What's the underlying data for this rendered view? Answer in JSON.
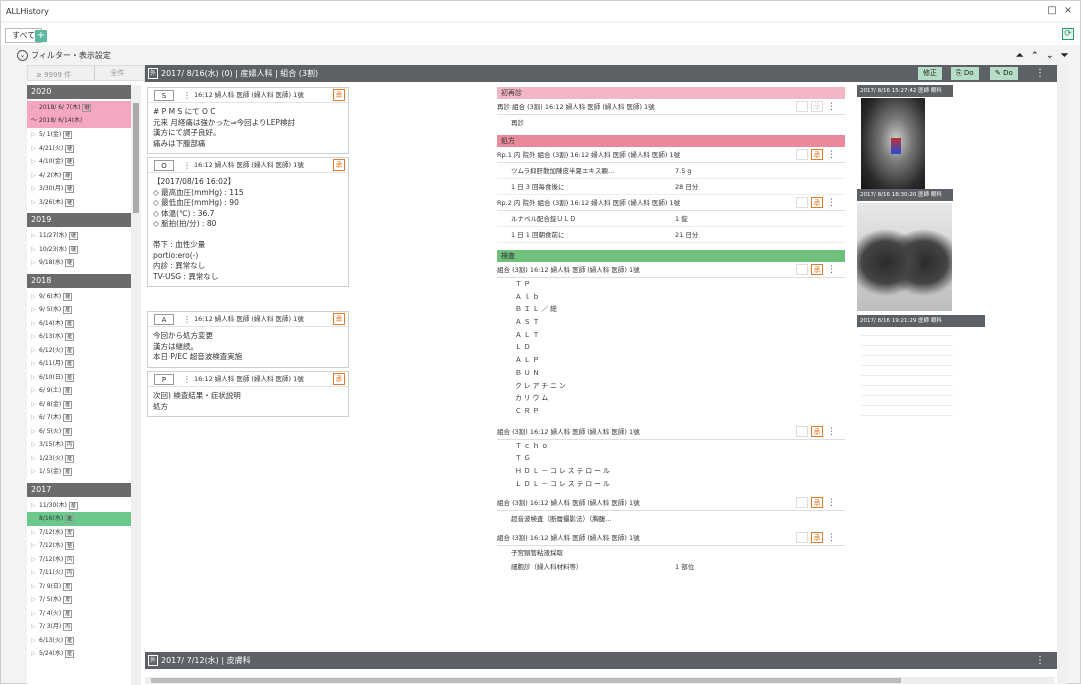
{
  "window": {
    "title": "ALLHistory",
    "minimize": "□",
    "close": "×"
  },
  "tabs": {
    "all": "すべて",
    "add": "+"
  },
  "filter": {
    "toggle": "⊙",
    "label": "フィルター・表示設定"
  },
  "counts": {
    "count": "≥ 9999 件",
    "all": "全件"
  },
  "years": [
    {
      "year": "2020",
      "items": [
        {
          "date": "2018/ 6/ 7(木)",
          "badge": "継",
          "extra": "～ 2018/ 6/14(木)",
          "hl": "pink"
        },
        {
          "date": "5/ 1(金)",
          "badge": "継"
        },
        {
          "date": "4/21(火)",
          "badge": "継"
        },
        {
          "date": "4/10(金)",
          "badge": "継"
        },
        {
          "date": "4/ 2(木)",
          "badge": "継"
        },
        {
          "date": "3/30(月)",
          "badge": "継"
        },
        {
          "date": "3/26(木)",
          "badge": "継"
        }
      ]
    },
    {
      "year": "2019",
      "items": [
        {
          "date": "11/27(水)",
          "badge": "継"
        },
        {
          "date": "10/23(水)",
          "badge": "継"
        },
        {
          "date": "9/18(水)",
          "badge": "継"
        }
      ]
    },
    {
      "year": "2018",
      "items": [
        {
          "date": "9/ 6(木)",
          "badge": "継"
        },
        {
          "date": "9/ 5(水)",
          "badge": "産"
        },
        {
          "date": "6/14(木)",
          "badge": "産"
        },
        {
          "date": "6/13(水)",
          "badge": "産"
        },
        {
          "date": "6/12(火)",
          "badge": "産"
        },
        {
          "date": "6/11(月)",
          "badge": "産"
        },
        {
          "date": "6/10(日)",
          "badge": "産"
        },
        {
          "date": "6/ 9(土)",
          "badge": "産"
        },
        {
          "date": "6/ 8(金)",
          "badge": "産"
        },
        {
          "date": "6/ 7(木)",
          "badge": "産"
        },
        {
          "date": "6/ 5(火)",
          "badge": "産"
        },
        {
          "date": "3/15(木)",
          "badge": "内"
        },
        {
          "date": "1/23(火)",
          "badge": "産"
        },
        {
          "date": "1/ 5(金)",
          "badge": "産"
        }
      ]
    },
    {
      "year": "2017",
      "items": [
        {
          "date": "11/30(木)",
          "badge": "産"
        },
        {
          "date": "8/16(水)",
          "badge": "産",
          "hl": "sel"
        },
        {
          "date": "7/12(水)",
          "badge": "皮"
        },
        {
          "date": "7/12(水)",
          "badge": "整"
        },
        {
          "date": "7/12(水)",
          "badge": "内"
        },
        {
          "date": "7/11(火)",
          "badge": "内"
        },
        {
          "date": "7/ 9(日)",
          "badge": "皮"
        },
        {
          "date": "7/ 5(水)",
          "badge": "皮"
        },
        {
          "date": "7/ 4(火)",
          "badge": "産"
        },
        {
          "date": "7/ 3(月)",
          "badge": "内"
        },
        {
          "date": "6/13(火)",
          "badge": "産"
        },
        {
          "date": "5/24(水)",
          "badge": "産"
        }
      ]
    }
  ],
  "header": {
    "icon": "外",
    "title": "2017/ 8/16(水) (0)  |  産婦人科  |  組合 (3割)",
    "edit": "修正",
    "do1": "Do",
    "do2": "Do"
  },
  "soap": [
    {
      "letter": "S",
      "head": "16:12 婦人科  医師 (婦人科  医師) 1號",
      "stamp": "承",
      "lines": [
        "# P M S にて O C",
        "元来  月経痛は強かった⇒今回よりLEP検討",
        "漢方にて調子良好。",
        "痛みは下腹部痛"
      ]
    },
    {
      "letter": "O",
      "head": "16:12 婦人科  医師 (婦人科  医師) 1號",
      "stamp": "承",
      "lines": [
        "【2017/08/16 16:02】",
        "◇  最高血圧(mmHg) : 115",
        "◇  最低血圧(mmHg) : 90",
        "◇  体温(℃) : 36.7",
        "◇  脈拍(拍/分) : 80",
        "",
        "帯下 : 血性少量",
        "portio:ero(-)",
        "内診 : 異常なし",
        "TV-USG : 異常なし"
      ]
    },
    {
      "letter": "A",
      "head": "16:12 婦人科  医師 (婦人科  医師) 1號",
      "stamp": "承",
      "lines": [
        "今回から処方変更",
        "漢方は継続。",
        "本日  P/EC  超音波検査実施"
      ]
    },
    {
      "letter": "P",
      "head": "16:12 婦人科  医師 (婦人科  医師) 1號",
      "stamp": "承",
      "lines": [
        "次回) 検査結果・症状説明",
        "処方"
      ]
    }
  ],
  "mid": {
    "sec1": "初再診",
    "row1": "再診  組合 (3割)  16:12 婦人科  医師 (婦人科  医師) 1號",
    "row1sub": "再診",
    "sec2": "処方",
    "rp1": "Rp.1  内  院外  組合 (3割)  16:12 婦人科  医師 (婦人科  医師) 1號",
    "rp1a": "ツムラ抑肝散加陳皮半夏エキス顆…",
    "rp1av": "7.5 g",
    "rp1b": "1 日 3 回毎食後に",
    "rp1bv": "28 日分",
    "rp2": "Rp.2  内  院外  組合 (3割)  16:12 婦人科  医師 (婦人科  医師) 1號",
    "rp2a": "ルナベル配合錠ＵＬＤ",
    "rp2av": "1 錠",
    "rp2b": "1 日 1 回朝食前に",
    "rp2bv": "21 日分",
    "sec3": "検査",
    "ex1": "組合 (3割)  16:12 婦人科  医師 (婦人科  医師) 1號",
    "tests1": [
      "ＴＰ",
      "Ａｌｂ",
      "ＢＩＬ／総",
      "ＡＳＴ",
      "ＡＬＴ",
      "ＬＤ",
      "ＡＬＰ",
      "ＢＵＮ",
      "クレアチニン",
      "カリウム",
      "ＣＲＰ"
    ],
    "ex2": "組合 (3割)  16:12 婦人科  医師 (婦人科  医師) 1號",
    "tests2": [
      "Ｔｃｈｏ",
      "ＴＧ",
      "ＨＤＬ－コレステロール",
      "ＬＤＬ－コレステロール"
    ],
    "ex3": "組合 (3割)  16:12 婦人科  医師 (婦人科  医師) 1號",
    "ex3sub": "超音波検査（断層撮影法）（胸腹…",
    "ex4": "組合 (3割)  16:12 婦人科  医師 (婦人科  医師) 1號",
    "ex4a": "子宮頸管粘液採取",
    "ex4b": "細胞診（婦人科材料等）",
    "ex4bv": "1 部位",
    "stamp": "承",
    "kebab": "⋮"
  },
  "images": [
    {
      "label": "2017/ 8/16 15:27:42 医師  眼科"
    },
    {
      "label": "2017/ 8/16 18:30:20 医師  眼科"
    },
    {
      "label": "2017/ 8/16 19:21:29 医師  眼科"
    }
  ],
  "bottom": {
    "icon": "外",
    "title": "2017/ 7/12(水)  |  皮膚科"
  }
}
